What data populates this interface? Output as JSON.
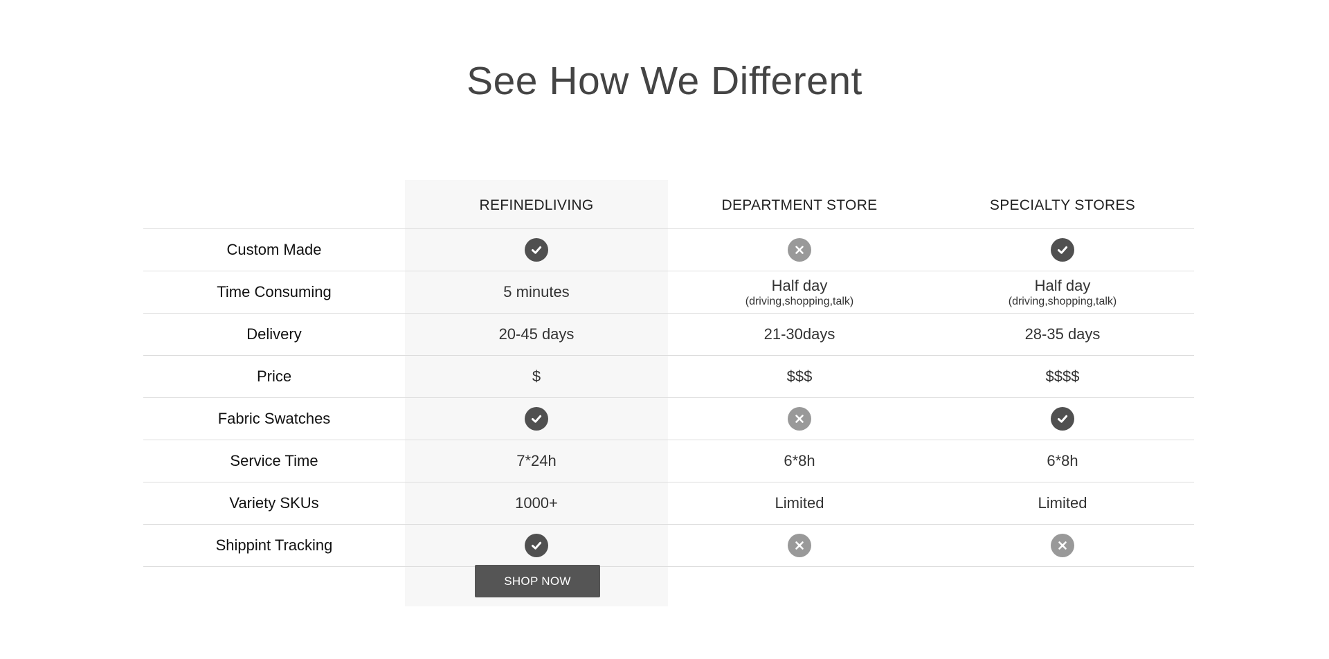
{
  "title": "See How We Different",
  "columns": {
    "refined": "REFINEDLIVING",
    "dept": "DEPARTMENT STORE",
    "spec": "SPECIALTY STORES"
  },
  "rows": [
    {
      "label": "Custom Made",
      "refined": {
        "icon": "check-icon"
      },
      "dept": {
        "icon": "cross-icon"
      },
      "spec": {
        "icon": "check-icon"
      }
    },
    {
      "label": "Time Consuming",
      "refined": {
        "text": "5 minutes"
      },
      "dept": {
        "text": "Half day",
        "sub": "(driving,shopping,talk)"
      },
      "spec": {
        "text": "Half day",
        "sub": "(driving,shopping,talk)"
      }
    },
    {
      "label": "Delivery",
      "refined": {
        "text": "20-45 days"
      },
      "dept": {
        "text": "21-30days"
      },
      "spec": {
        "text": "28-35 days"
      }
    },
    {
      "label": "Price",
      "refined": {
        "text": "$"
      },
      "dept": {
        "text": "$$$"
      },
      "spec": {
        "text": "$$$$"
      }
    },
    {
      "label": "Fabric Swatches",
      "refined": {
        "icon": "check-icon"
      },
      "dept": {
        "icon": "cross-icon"
      },
      "spec": {
        "icon": "check-icon"
      }
    },
    {
      "label": "Service Time",
      "refined": {
        "text": "7*24h"
      },
      "dept": {
        "text": "6*8h"
      },
      "spec": {
        "text": "6*8h"
      }
    },
    {
      "label": "Variety SKUs",
      "refined": {
        "text": "1000+"
      },
      "dept": {
        "text": "Limited"
      },
      "spec": {
        "text": "Limited"
      }
    },
    {
      "label": "Shippint Tracking",
      "refined": {
        "icon": "check-icon"
      },
      "dept": {
        "icon": "cross-icon"
      },
      "spec": {
        "icon": "cross-icon"
      }
    }
  ],
  "button": {
    "label": "SHOP NOW"
  },
  "colors": {
    "check_icon": "#505050",
    "cross_icon": "#999999",
    "highlight_column": "#f7f7f7",
    "button_bg": "#555555"
  }
}
